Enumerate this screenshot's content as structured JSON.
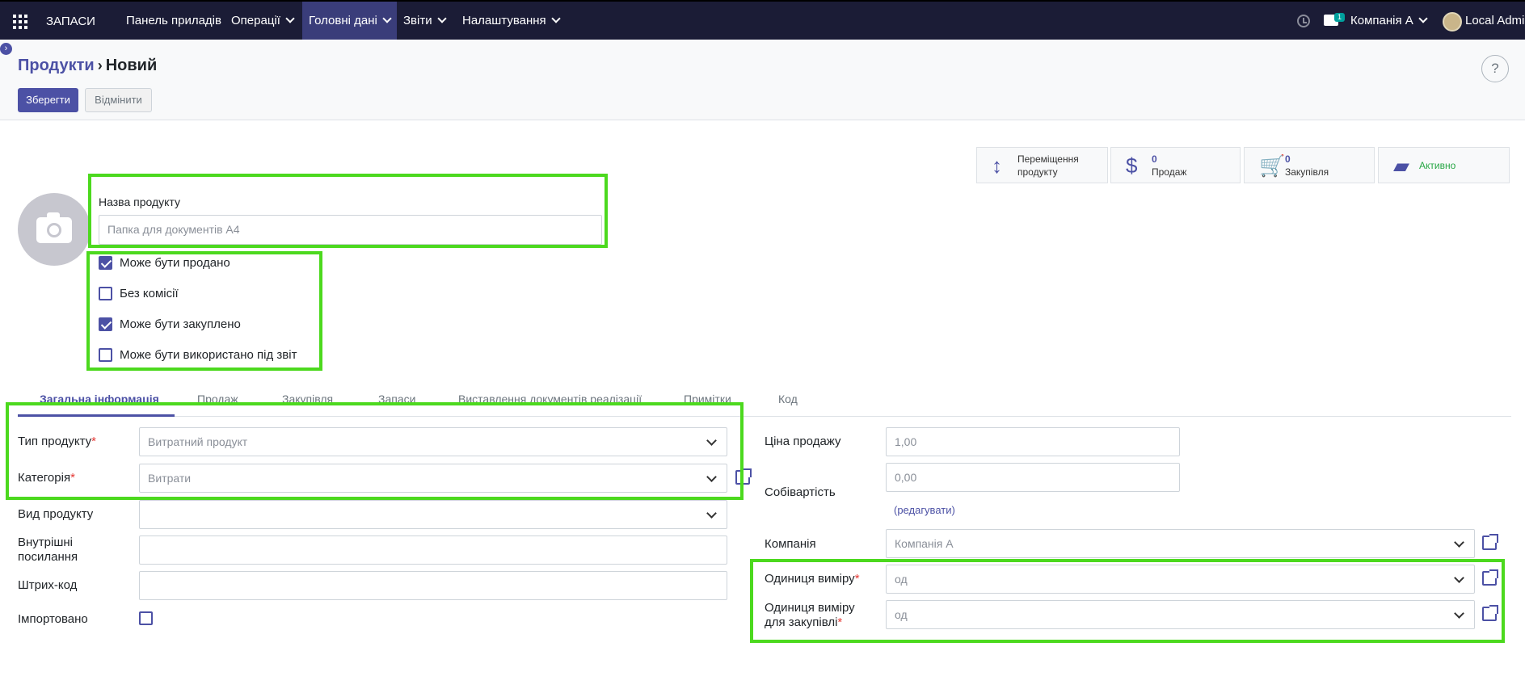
{
  "topbar": {
    "app_name": "ЗАПАСИ",
    "menu": [
      "Панель приладів",
      "Операції",
      "Головні дані",
      "Звіти",
      "Налаштування"
    ],
    "chat_badge": "1",
    "company": "Компанія А",
    "user": "Local Admin"
  },
  "breadcrumb": {
    "parent": "Продукти",
    "current": "Новий"
  },
  "actions": {
    "save": "Зберегти",
    "cancel": "Відмінити",
    "help": "?"
  },
  "stats": [
    {
      "icon": "arrows-vertical-icon",
      "line1": "Переміщення",
      "line2": "продукту"
    },
    {
      "icon": "dollar-icon",
      "count": "0",
      "label": "Продаж"
    },
    {
      "icon": "cart-icon",
      "count": "0",
      "label": "Закупівля"
    },
    {
      "icon": "archive-icon",
      "label": "Активно"
    }
  ],
  "product_name": {
    "label": "Назва продукту",
    "placeholder": "Папка для документів А4"
  },
  "options": [
    {
      "label": "Може бути продано",
      "checked": true
    },
    {
      "label": "Без комісії",
      "checked": false
    },
    {
      "label": "Може бути закуплено",
      "checked": true
    },
    {
      "label": "Може бути використано під звіт",
      "checked": false
    }
  ],
  "tabs": [
    "Загальна інформація",
    "Продаж",
    "Закупівля",
    "Запаси",
    "Виставлення документів реалізації",
    "Примітки",
    "Код"
  ],
  "left_fields": {
    "product_type": {
      "label": "Тип продукту",
      "value": "Витратний продукт"
    },
    "category": {
      "label": "Категорія",
      "value": "Витрати"
    },
    "product_kind": {
      "label": "Вид продукту",
      "value": ""
    },
    "internal_ref_1": "Внутрішні",
    "internal_ref_2": "посилання",
    "barcode": "Штрих-код",
    "imported": "Імпортовано"
  },
  "right_fields": {
    "sale_price": {
      "label": "Ціна продажу",
      "value": "1,00"
    },
    "cost": {
      "label": "Собівартість",
      "value": "0,00",
      "edit": "(редагувати)"
    },
    "company": {
      "label": "Компанія",
      "value": "Компанія А"
    },
    "uom": {
      "label": "Одиниця виміру",
      "value": "од"
    },
    "purchase_uom": {
      "label_1": "Одиниця виміру",
      "label_2": "для закупівлі",
      "value": "од"
    }
  }
}
